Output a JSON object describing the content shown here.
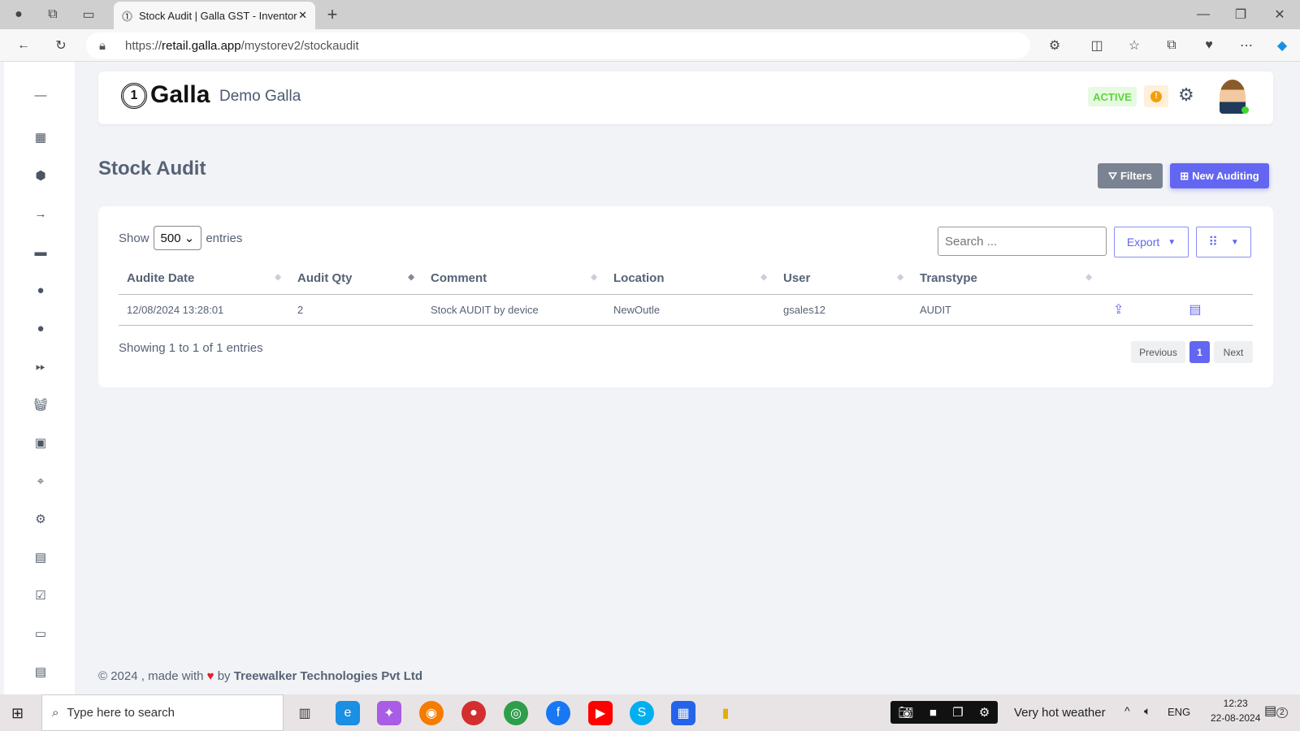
{
  "browser": {
    "tab_title": "Stock Audit | Galla GST - Inventor",
    "url_prefix": "https://",
    "url_host": "retail.galla.app",
    "url_path": "/mystorev2/stockaudit"
  },
  "header": {
    "logo": "Galla",
    "store": "Demo Galla",
    "status": "ACTIVE",
    "alert": "!"
  },
  "page": {
    "title": "Stock Audit",
    "filters_label": "Filters",
    "new_label": "New Auditing"
  },
  "table_controls": {
    "show": "Show",
    "entries_value": "500",
    "entries": "entries",
    "search_placeholder": "Search ...",
    "export": "Export"
  },
  "table": {
    "columns": [
      "Audite Date",
      "Audit Qty",
      "Comment",
      "Location",
      "User",
      "Transtype"
    ],
    "rows": [
      {
        "date": "12/08/2024 13:28:01",
        "qty": "2",
        "comment": "Stock AUDIT by device",
        "location": "NewOutle",
        "user": "gsales12",
        "transtype": "AUDIT"
      }
    ]
  },
  "pagination": {
    "info": "Showing 1 to 1 of 1 entries",
    "previous": "Previous",
    "current": "1",
    "next": "Next"
  },
  "footer": {
    "prefix": "© 2024 , made with",
    "by": "by",
    "company": "Treewalker Technologies Pvt Ltd"
  },
  "taskbar": {
    "search_placeholder": "Type here to search",
    "weather": "Very hot weather",
    "lang": "ENG",
    "time": "12:23",
    "date": "22-08-2024",
    "notifications": "2"
  },
  "colors": {
    "accent": "#6366f1",
    "active_bg": "#e6f9e1",
    "active_text": "#5cd63a",
    "filters_bg": "#7a8391"
  }
}
